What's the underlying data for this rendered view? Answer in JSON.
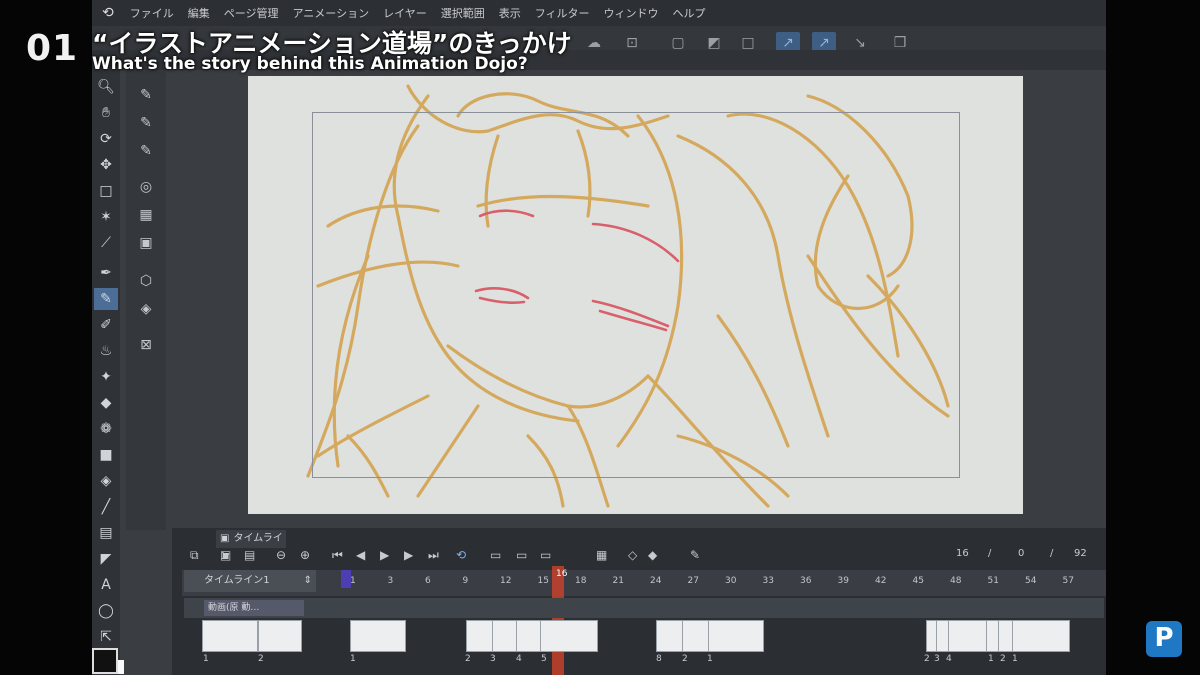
{
  "menu": [
    "ファイル",
    "編集",
    "ページ管理",
    "アニメーション",
    "レイヤー",
    "選択範囲",
    "表示",
    "フィルター",
    "ウィンドウ",
    "ヘルプ"
  ],
  "overlay": {
    "episode_number": "01",
    "title_jp": "“イラストアニメーション道場”のきっかけ",
    "title_en": "What's the story behind this Animation Dojo?"
  },
  "timeline": {
    "tab_label": "タイムライン",
    "timeline_name": "タイムライン1",
    "layer_name": "動画(原 動…",
    "frame_numbers": [
      "1",
      "3",
      "6",
      "9",
      "12",
      "15",
      "18",
      "21",
      "24",
      "27",
      "30",
      "33",
      "36",
      "39",
      "42",
      "45",
      "48",
      "51",
      "54",
      "57"
    ],
    "current_frame": "16",
    "counters": [
      "16",
      "/",
      "0",
      "/",
      "92"
    ],
    "cel_numbers": [
      "1",
      "2",
      "1",
      "2",
      "3",
      "4",
      "5",
      "8",
      "2",
      "1",
      "2",
      "3",
      "4",
      "1",
      "2",
      "1"
    ]
  },
  "colors": {
    "sketch": "#d4a95e",
    "eyes": "#d9606b",
    "accent": "#1e78c4",
    "playhead": "#c5412c"
  },
  "icons": [
    "hand-icon",
    "move-icon",
    "select-icon",
    "wand-icon",
    "eyedropper-icon",
    "pen-icon",
    "pencil-icon",
    "brush-icon",
    "airbrush-icon",
    "eraser-icon",
    "fill-icon",
    "gradient-icon",
    "line-icon",
    "text-icon",
    "lasso-icon"
  ]
}
